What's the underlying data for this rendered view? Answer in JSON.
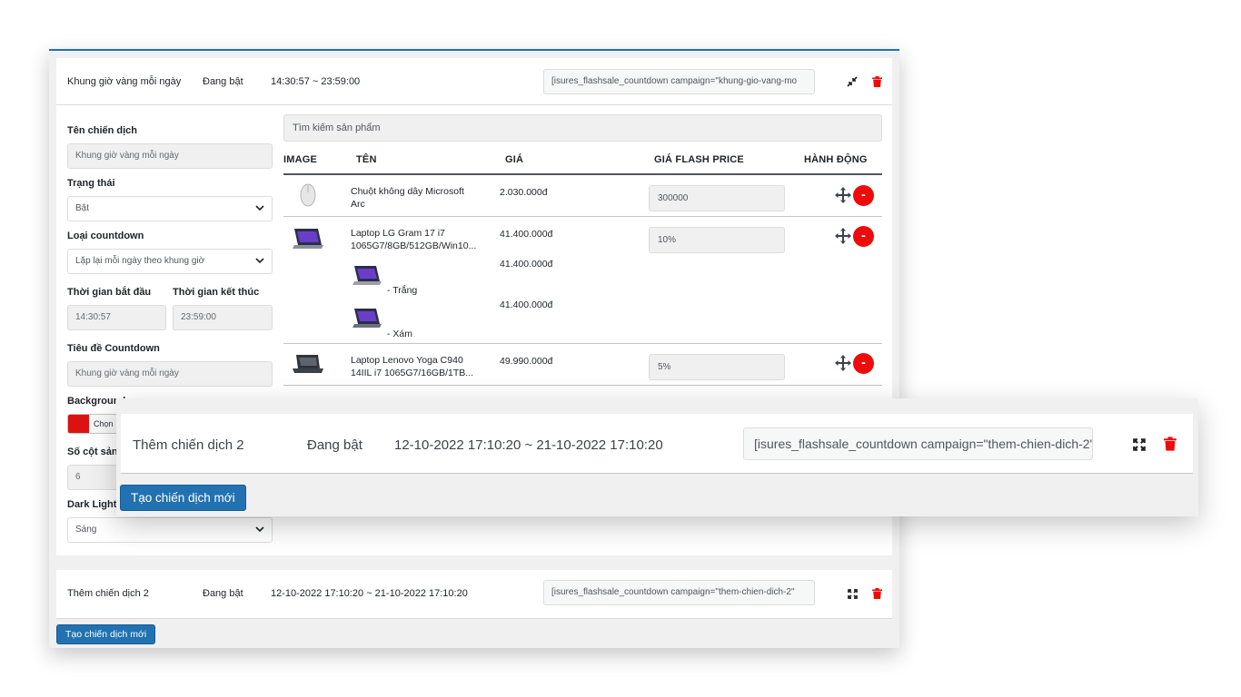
{
  "campaign1": {
    "name": "Khung giờ vàng mỗi ngày",
    "status": "Đang bật",
    "time_range": "14:30:57 ~ 23:59:00",
    "shortcode": "[isures_flashsale_countdown campaign=\"khung-gio-vang-mo"
  },
  "form": {
    "name_label": "Tên chiến dịch",
    "name_value": "Khung giờ vàng mỗi ngày",
    "status_label": "Trạng thái",
    "status_value": "Bật",
    "countdown_type_label": "Loại countdown",
    "countdown_type_value": "Lặp lại mỗi ngày theo khung giờ",
    "start_label": "Thời gian bắt đầu",
    "start_value": "14:30:57",
    "end_label": "Thời gian kết thúc",
    "end_value": "23:59:00",
    "countdown_title_label": "Tiêu đề Countdown",
    "countdown_title_value": "Khung giờ vàng mỗi ngày",
    "background_label": "Background",
    "background_button": "Chọn",
    "background_color": "#dd1111",
    "columns_label": "Số cột sản",
    "columns_value": "6",
    "mode_label": "Dark Light",
    "mode_value": "Sáng"
  },
  "products": {
    "search_placeholder": "Tìm kiếm sản phẩm",
    "headers": {
      "image": "IMAGE",
      "name": "TÊN",
      "price": "GIÁ",
      "flash_price": "GIÁ FLASH PRICE",
      "action": "HÀNH ĐỘNG"
    },
    "rows": [
      {
        "name_line1": "Chuột không dây Microsoft",
        "name_line2": "Arc",
        "price": "2.030.000đ",
        "flash": "300000",
        "icon": "mouse-image"
      },
      {
        "name_line1": "Laptop LG Gram 17 i7",
        "name_line2": "1065G7/8GB/512GB/Win10...",
        "price": "41.400.000đ",
        "flash": "10%",
        "icon": "laptop-image",
        "variants": [
          {
            "label": "- Trắng",
            "price": "41.400.000đ"
          },
          {
            "label": "- Xám",
            "price": "41.400.000đ"
          }
        ]
      },
      {
        "name_line1": "Laptop Lenovo Yoga C940",
        "name_line2": "14IIL i7 1065G7/16GB/1TB...",
        "price": "49.990.000đ",
        "flash": "5%",
        "icon": "laptop-image"
      }
    ],
    "remove_label": "-"
  },
  "campaign2": {
    "name": "Thêm chiến dịch 2",
    "status": "Đang bật",
    "time_range": "12-10-2022 17:10:20 ~ 21-10-2022 17:10:20",
    "shortcode": "[isures_flashsale_countdown campaign=\"them-chien-dich-2\""
  },
  "create_button": "Tạo chiến dịch mới",
  "colors": {
    "accent": "#2271b1",
    "danger": "#ee0b0b"
  }
}
